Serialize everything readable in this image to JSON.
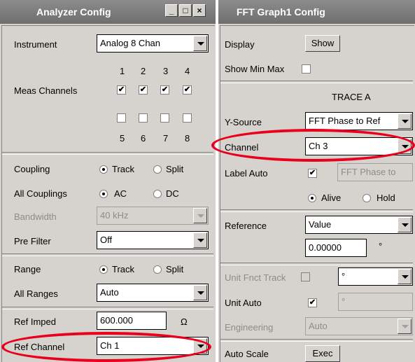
{
  "analyzer": {
    "title": "Analyzer Config",
    "instrument": {
      "label": "Instrument",
      "value": "Analog  8 Chan"
    },
    "meas_channels": {
      "label": "Meas Channels",
      "top_numbers": [
        "1",
        "2",
        "3",
        "4"
      ],
      "bottom_numbers": [
        "5",
        "6",
        "7",
        "8"
      ],
      "top_checks": [
        "✔",
        "✔",
        "✔",
        "✔"
      ]
    },
    "coupling": {
      "label": "Coupling",
      "opt1": "Track",
      "opt2": "Split"
    },
    "all_couplings": {
      "label": "All Couplings",
      "opt1": "AC",
      "opt2": "DC"
    },
    "bandwidth": {
      "label": "Bandwidth",
      "value": "40 kHz"
    },
    "pre_filter": {
      "label": "Pre Filter",
      "value": "Off"
    },
    "range": {
      "label": "Range",
      "opt1": "Track",
      "opt2": "Split"
    },
    "all_ranges": {
      "label": "All Ranges",
      "value": "Auto"
    },
    "ref_imped": {
      "label": "Ref Imped",
      "value": "600.000",
      "unit": "Ω"
    },
    "ref_channel": {
      "label": "Ref Channel",
      "value": "Ch 1"
    }
  },
  "fft": {
    "title": "FFT Graph1 Config",
    "display": {
      "label": "Display",
      "button": "Show"
    },
    "show_min_max": {
      "label": "Show Min Max"
    },
    "trace_header": "TRACE A",
    "y_source": {
      "label": "Y-Source",
      "value": "FFT Phase to Ref"
    },
    "channel": {
      "label": "Channel",
      "value": "Ch 3"
    },
    "label_auto": {
      "label": "Label Auto",
      "check": "✔",
      "value": "FFT Phase to"
    },
    "alive_hold": {
      "opt1": "Alive",
      "opt2": "Hold"
    },
    "reference": {
      "label": "Reference",
      "value": "Value",
      "number": "0.00000",
      "unit": "°"
    },
    "unit_fnct_track": {
      "label": "Unit Fnct Track",
      "value": "°"
    },
    "unit_auto": {
      "label": "Unit Auto",
      "check": "✔",
      "value": "°"
    },
    "engineering": {
      "label": "Engineering",
      "value": "Auto"
    },
    "auto_scale": {
      "label": "Auto Scale",
      "button": "Exec"
    }
  },
  "highlight_color": "#e8001c"
}
